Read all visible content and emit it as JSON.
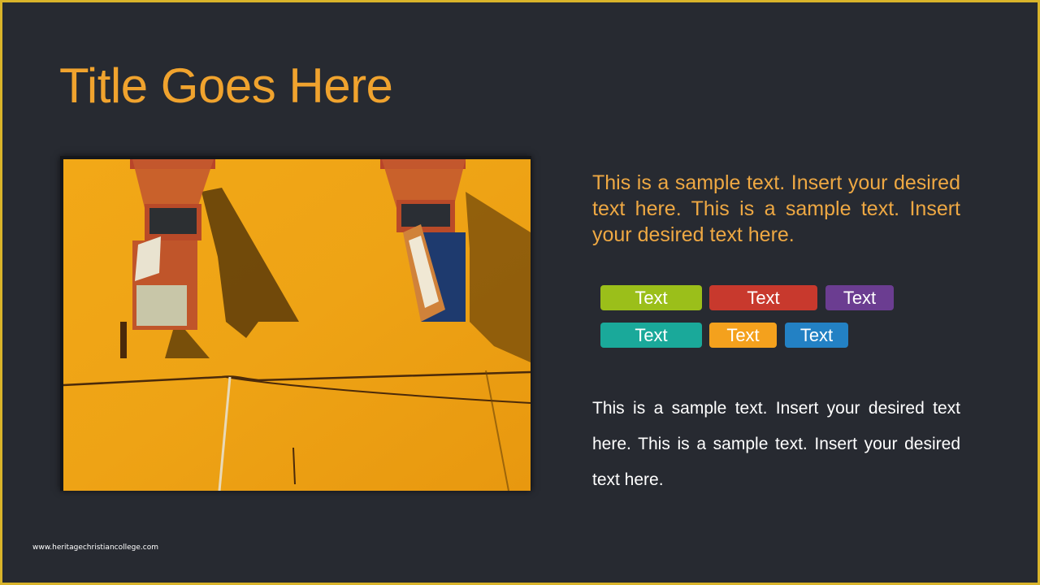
{
  "slide": {
    "title": "Title Goes Here",
    "paragraph_1": "This is a sample text. Insert your desired text here. This is a sample text. Insert your desired text here.",
    "paragraph_2": "This is a sample text. Insert your desired text here. This is a sample text. Insert your desired text here.",
    "footer_url": "www.heritagechristiancollege.com",
    "photo": {
      "description": "yellow-orange wall with two wooden windows, open shutters and cast shadows"
    },
    "tags": [
      {
        "label": "Text",
        "color": "#9bbf1a"
      },
      {
        "label": "Text",
        "color": "#c8392d"
      },
      {
        "label": "Text",
        "color": "#6b3d91"
      },
      {
        "label": "Text",
        "color": "#1aa99a"
      },
      {
        "label": "Text",
        "color": "#f4a11d"
      },
      {
        "label": "Text",
        "color": "#2381c4"
      }
    ]
  },
  "colors": {
    "background": "#272a31",
    "border": "#d9b42a",
    "accent": "#f0a32e"
  }
}
